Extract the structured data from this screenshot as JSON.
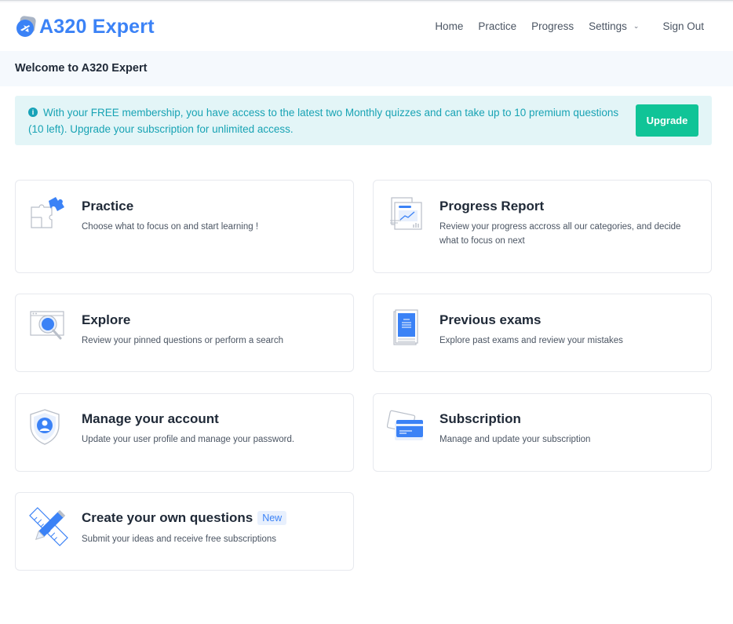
{
  "brand": {
    "name": "A320 Expert"
  },
  "nav": {
    "home": "Home",
    "practice": "Practice",
    "progress": "Progress",
    "settings": "Settings",
    "signout": "Sign Out"
  },
  "welcome": {
    "title": "Welcome to A320 Expert"
  },
  "alert": {
    "text": "With your FREE membership, you have access to the latest two Monthly quizzes and can take up to 10 premium questions (10 left). Upgrade your subscription for unlimited access.",
    "button": "Upgrade"
  },
  "cards": {
    "practice": {
      "title": "Practice",
      "desc": "Choose what to focus on and start learning !"
    },
    "progress": {
      "title": "Progress Report",
      "desc": "Review your progress accross all our categories, and decide what to focus on next"
    },
    "explore": {
      "title": "Explore",
      "desc": "Review your pinned questions or perform a search"
    },
    "exams": {
      "title": "Previous exams",
      "desc": "Explore past exams and review your mistakes"
    },
    "account": {
      "title": "Manage your account",
      "desc": "Update your user profile and manage your password."
    },
    "subscription": {
      "title": "Subscription",
      "desc": "Manage and update your subscription"
    },
    "create": {
      "title": "Create your own questions",
      "badge": "New",
      "desc": "Submit your ideas and receive free subscriptions"
    }
  },
  "colors": {
    "accent": "#3b82f6",
    "success": "#10c497",
    "info": "#18a3b4",
    "info_bg": "#e3f5f7"
  },
  "icons": [
    "plane-icon",
    "chevron-down-icon",
    "info-icon",
    "puzzle-icon",
    "report-icon",
    "magnifier-icon",
    "book-icon",
    "shield-user-icon",
    "credit-card-icon",
    "pencil-ruler-icon"
  ]
}
